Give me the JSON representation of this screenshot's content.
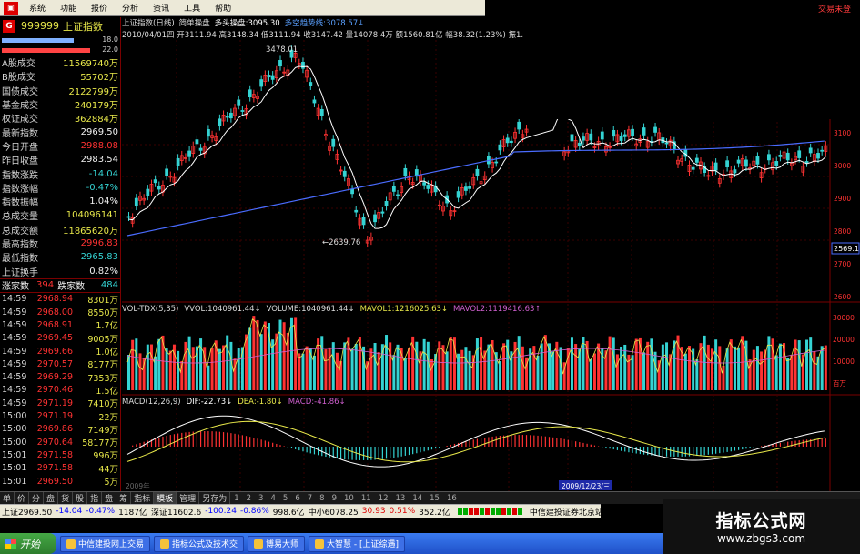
{
  "menu": {
    "items": [
      "系统",
      "功能",
      "报价",
      "分析",
      "资讯",
      "工具",
      "帮助"
    ],
    "right_label": "交易未登"
  },
  "stock": {
    "badge": "G",
    "code": "999999",
    "name": "上证指数"
  },
  "progress": [
    {
      "pct_label": "18.0",
      "value": 0.18,
      "color": "#7fb0ff"
    },
    {
      "pct_label": "22.0",
      "value": 0.22,
      "color": "#ff4444"
    }
  ],
  "stats": [
    {
      "label": "A股成交",
      "value": "11569740万",
      "color": "yel"
    },
    {
      "label": "B股成交",
      "value": "55702万",
      "color": "yel"
    },
    {
      "label": "国债成交",
      "value": "2122799万",
      "color": "yel"
    },
    {
      "label": "基金成交",
      "value": "240179万",
      "color": "yel"
    },
    {
      "label": "权证成交",
      "value": "362884万",
      "color": "yel"
    },
    {
      "label": "最新指数",
      "value": "2969.50",
      "color": "wht"
    },
    {
      "label": "今日开盘",
      "value": "2988.08",
      "color": "red"
    },
    {
      "label": "昨日收盘",
      "value": "2983.54",
      "color": "wht"
    },
    {
      "label": "指数涨跌",
      "value": "-14.04",
      "color": "grn"
    },
    {
      "label": "指数涨幅",
      "value": "-0.47%",
      "color": "grn"
    },
    {
      "label": "指数振幅",
      "value": "1.04%",
      "color": "wht"
    },
    {
      "label": "总成交量",
      "value": "104096141",
      "color": "yel"
    },
    {
      "label": "总成交额",
      "value": "11865620万",
      "color": "yel"
    },
    {
      "label": "最高指数",
      "value": "2996.83",
      "color": "red"
    },
    {
      "label": "最低指数",
      "value": "2965.83",
      "color": "grn"
    },
    {
      "label": "上证换手",
      "value": "0.82%",
      "color": "wht"
    }
  ],
  "updown": {
    "up_label": "涨家数",
    "up": "394",
    "down_label": "跌家数",
    "down": "484"
  },
  "ticks": [
    {
      "t": "14:59",
      "p": "2968.94",
      "v": "8301万"
    },
    {
      "t": "14:59",
      "p": "2968.00",
      "v": "8550万"
    },
    {
      "t": "14:59",
      "p": "2968.91",
      "v": "1.7亿"
    },
    {
      "t": "14:59",
      "p": "2969.45",
      "v": "9005万"
    },
    {
      "t": "14:59",
      "p": "2969.66",
      "v": "1.0亿"
    },
    {
      "t": "14:59",
      "p": "2970.57",
      "v": "8177万"
    },
    {
      "t": "14:59",
      "p": "2969.29",
      "v": "7353万"
    },
    {
      "t": "14:59",
      "p": "2970.46",
      "v": "1.5亿"
    },
    {
      "t": "14:59",
      "p": "2971.19",
      "v": "7410万"
    },
    {
      "t": "15:00",
      "p": "2971.19",
      "v": "22万"
    },
    {
      "t": "15:00",
      "p": "2969.86",
      "v": "7149万"
    },
    {
      "t": "15:00",
      "p": "2970.64",
      "v": "58177万"
    },
    {
      "t": "15:01",
      "p": "2971.58",
      "v": "996万"
    },
    {
      "t": "15:01",
      "p": "2971.58",
      "v": "44万"
    },
    {
      "t": "15:01",
      "p": "2969.50",
      "v": "5万"
    }
  ],
  "chart_header": {
    "name": "上证指数(日线)",
    "mode": "简单操盘",
    "signal": "多头操盘:3095.30",
    "line": "多空趋势线:3078.57↓",
    "ohlc": "2010/04/01四 开3111.94 高3148.34 低3111.94 收3147.42 量14078.4万 额1560.81亿 幅38.32(1.23%) 振1."
  },
  "price_labels": {
    "high": "3478.01",
    "low": "←2639.76",
    "current": "2569.1"
  },
  "right_axis": {
    "main": [
      "3100",
      "3000",
      "2900",
      "2800",
      "2700",
      "2600"
    ],
    "vol": [
      "30000",
      "20000",
      "10000",
      "百万"
    ]
  },
  "vol_header": {
    "indicator": "VOL-TDX(5,35)",
    "vvol": "VVOL:1040961.44↓",
    "volume": "VOLUME:1040961.44↓",
    "mavol1": "MAVOL1:1216025.63↓",
    "mavol2": "MAVOL2:1119416.63↑"
  },
  "macd_header": {
    "indicator": "MACD(12,26,9)",
    "dif": "DIF:-22.73↓",
    "dea": "DEA:-1.80↓",
    "macd": "MACD:-41.86↓"
  },
  "date_labels": {
    "start": "2009年",
    "highlight": "2009/12/23/三"
  },
  "tabs": [
    "指标",
    "模板",
    "管理",
    "另存为"
  ],
  "tab_active": "模板",
  "tab_numbers": [
    "1",
    "2",
    "3",
    "4",
    "5",
    "6",
    "7",
    "8",
    "9",
    "10",
    "11",
    "12",
    "13",
    "14",
    "15",
    "16"
  ],
  "side_tabs": [
    "单",
    "价",
    "分",
    "盘",
    "货",
    "股",
    "指",
    "盘",
    "筹"
  ],
  "ticker": {
    "sh": "上证2969.50",
    "sh_chg": "-14.04",
    "sh_pct": "-0.47%",
    "sh_amt": "1187亿",
    "sz": "深证11602.6",
    "sz_chg": "-100.24",
    "sz_pct": "-0.86%",
    "sz_amt": "998.6亿",
    "mid": "中小6078.25",
    "mid_chg": "30.93",
    "mid_pct": "0.51%",
    "mid_amt": "352.2亿",
    "broker": "中信建投证券北京站"
  },
  "taskbar": {
    "start": "开始",
    "tasks": [
      "中信建投网上交易",
      "指标公式及技术交",
      "博易大师",
      "大智慧 - [上证综遇]"
    ]
  },
  "watermark": {
    "line1": "指标公式网",
    "line2": "www.zbgs3.com"
  }
}
